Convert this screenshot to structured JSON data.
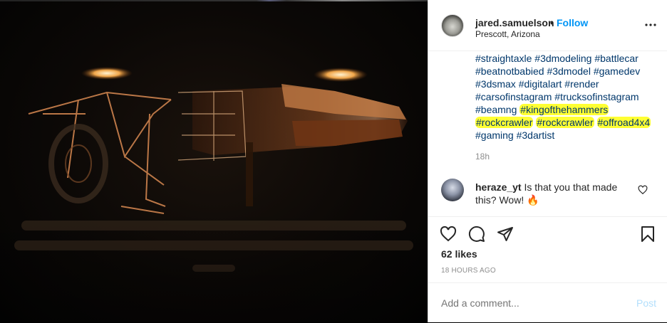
{
  "post": {
    "username": "jared.samuelson",
    "separator": "•",
    "follow_label": "Follow",
    "location": "Prescott, Arizona",
    "caption_lines": [
      [
        "#straightaxle",
        "#3dmodeling",
        "#battlecar"
      ],
      [
        "#beatnotbabied",
        "#3dmodel",
        "#gamedev"
      ],
      [
        "#3dsmax",
        "#digitalart",
        "#render"
      ],
      [
        "#carsofinstagram",
        "#trucksofinstagram"
      ],
      [
        "#beamng",
        "#kingofthehammers"
      ],
      [
        "#rockcrawler",
        "#rockcrawler",
        "#offroad4x4"
      ],
      [
        "#gaming",
        "#3dartist"
      ]
    ],
    "highlighted": [
      "#kingofthehammers",
      "#rockcrawler",
      "#offroad4x4"
    ],
    "caption_age": "18h",
    "likes": "62 likes",
    "posted": "18 HOURS AGO"
  },
  "comment": {
    "username": "heraze_yt",
    "text": " Is that you that made this? Wow! 🔥"
  },
  "composer": {
    "placeholder": "Add a comment...",
    "post_label": "Post"
  },
  "colors": {
    "link": "#00376b",
    "follow": "#0095f6",
    "highlight": "#ffff33",
    "muted": "#8e8e8e"
  },
  "icons": [
    "more-icon",
    "heart-icon",
    "comment-icon",
    "share-icon",
    "bookmark-icon",
    "small-heart-icon"
  ]
}
